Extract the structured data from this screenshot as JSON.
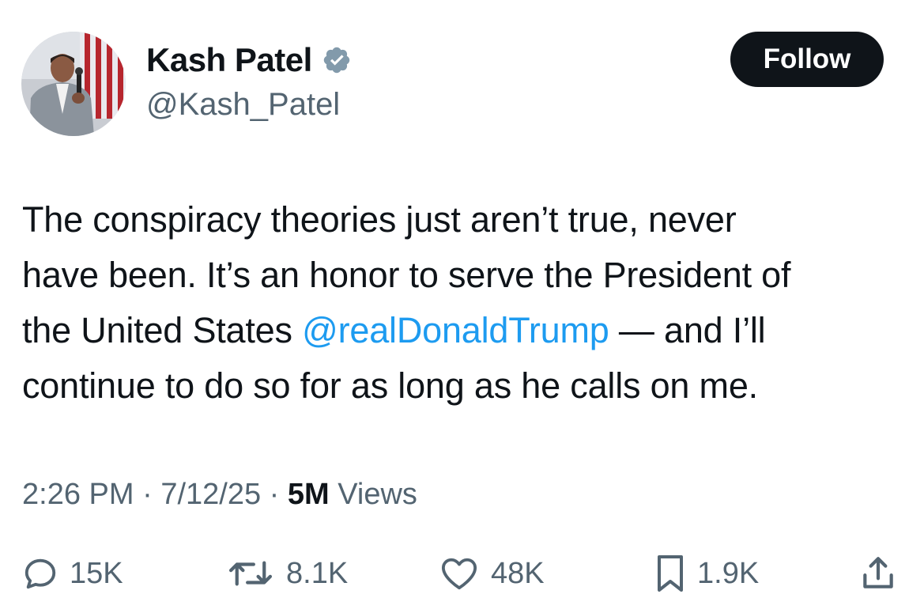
{
  "author": {
    "display_name": "Kash Patel",
    "handle": "@Kash_Patel",
    "verified": true
  },
  "follow_button": {
    "label": "Follow"
  },
  "tweet": {
    "lines": [
      [
        "The conspiracy theories just aren’t true, never"
      ],
      [
        "have been. It’s an honor to serve the President of"
      ],
      [
        "the United States ",
        "@realDonaldTrump",
        " — and I’ll"
      ],
      [
        "continue to do so for as long as he calls on me."
      ]
    ]
  },
  "meta": {
    "time": "2:26 PM",
    "separator": "·",
    "date": "7/12/25",
    "views_count": "5M",
    "views_label": "Views"
  },
  "actions": {
    "replies": {
      "icon": "reply-icon",
      "count": "15K"
    },
    "reposts": {
      "icon": "repost-icon",
      "count": "8.1K"
    },
    "likes": {
      "icon": "heart-icon",
      "count": "48K"
    },
    "bookmarks": {
      "icon": "bookmark-icon",
      "count": "1.9K"
    },
    "share": {
      "icon": "share-icon"
    }
  },
  "colors": {
    "text": "#0f1419",
    "secondary": "#536471",
    "mention": "#1d9bf0",
    "follow_bg": "#0f1419",
    "verified_badge": "#829aab"
  }
}
